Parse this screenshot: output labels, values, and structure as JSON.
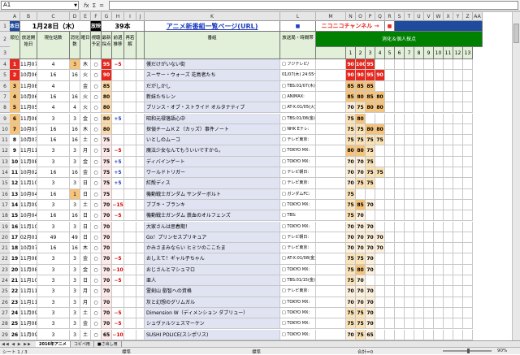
{
  "formula_bar": {
    "cell_ref": "A1",
    "formula": ""
  },
  "columns": [
    "A",
    "B",
    "C",
    "D",
    "E",
    "F",
    "G",
    "H",
    "I",
    "J",
    "K",
    "L",
    "M",
    "N",
    "O",
    "P",
    "Q",
    "R",
    "S",
    "T",
    "U",
    "V",
    "W",
    "X",
    "Y",
    "Z",
    "AA"
  ],
  "header": {
    "today_label": "本日",
    "date": "1月28日（木）",
    "count_label": "放映",
    "count": "39本",
    "title_link": "アニメ新番組一覧ページ(URL)",
    "marker_left": "■",
    "niconico": "ニコニコチャンネル →",
    "marker_right": "■",
    "score_group": "消化＆個人採点",
    "col_rank": "順位",
    "col_date": "放送開始日",
    "col_current": "現在話数",
    "col_watched": "消化数",
    "col_weekday": "曜日",
    "col_plan": "視聴予定",
    "col_latest": "最新採点",
    "col_prev": "前週推移",
    "col_diff": "再若解",
    "col_title": "番組",
    "col_station": "放送局・時間帯",
    "score_numbers": [
      "1",
      "2",
      "3",
      "4",
      "5",
      "6",
      "7",
      "8",
      "9",
      "10",
      "11",
      "12",
      "13"
    ]
  },
  "rows": [
    {
      "row": "1"
    },
    {
      "row": "2"
    },
    {
      "row": "3"
    },
    {
      "row": "4",
      "rank": "1",
      "date": "11月07日(木)",
      "cur": "4",
      "wat": "3",
      "wd": "木",
      "plan": "○",
      "score": "95",
      "trend": "−5",
      "title": "僕だけがいない街",
      "station": "□ フジテレビ/",
      "scores": [
        "90",
        "100",
        "95",
        "",
        "",
        "",
        "",
        "",
        "",
        "",
        "",
        "",
        ""
      ]
    },
    {
      "row": "5",
      "rank": "2",
      "date": "10月06日(火)",
      "cur": "16",
      "wat": "16",
      "wd": "火",
      "plan": "○",
      "score": "90",
      "trend": "",
      "title": "スーサー・ウォーズ 花鳥者たち",
      "station": "01/07(木) 24:55~",
      "scores": [
        "90",
        "90",
        "95",
        "90",
        "",
        "",
        "",
        "",
        "",
        "",
        "",
        "",
        ""
      ]
    },
    {
      "row": "6",
      "rank": "3",
      "date": "11月08日(金)",
      "cur": "4",
      "wat": "",
      "wd": "金",
      "plan": "○",
      "score": "85",
      "trend": "",
      "title": "だがしかし",
      "station": "□ TBS:01/07(木)",
      "scores": [
        "85",
        "85",
        "85",
        "",
        "",
        "",
        "",
        "",
        "",
        "",
        "",
        "",
        ""
      ]
    },
    {
      "row": "7",
      "rank": "4",
      "date": "10月06日(火)",
      "cur": "16",
      "wat": "16",
      "wd": "火",
      "plan": "○",
      "score": "80",
      "trend": "",
      "title": "新妹たちレン",
      "station": "□ ANIMAX:",
      "scores": [
        "85",
        "80",
        "85",
        "80",
        "",
        "",
        "",
        "",
        "",
        "",
        "",
        "",
        ""
      ]
    },
    {
      "row": "8",
      "rank": "5",
      "date": "11月05日(火)",
      "cur": "4",
      "wat": "4",
      "wd": "火",
      "plan": "○",
      "score": "80",
      "trend": "",
      "title": "プリンス・オブ・ストライド オルタナティブ",
      "station": "□ AT-X:01/05(火)",
      "scores": [
        "70",
        "75",
        "80",
        "80",
        "",
        "",
        "",
        "",
        "",
        "",
        "",
        "",
        ""
      ]
    },
    {
      "row": "9",
      "rank": "6",
      "date": "11月08日(金)",
      "cur": "3",
      "wat": "3",
      "wd": "金",
      "plan": "○",
      "score": "80",
      "trend": "+5",
      "title": "昭和元禄落語心中",
      "station": "□ TBS:01/08(金)",
      "scores": [
        "75",
        "80",
        "",
        "",
        "",
        "",
        "",
        "",
        "",
        "",
        "",
        "",
        ""
      ]
    },
    {
      "row": "10",
      "rank": "7",
      "date": "10月07日(木)",
      "cur": "16",
      "wat": "16",
      "wd": "木",
      "plan": "○",
      "score": "80",
      "trend": "",
      "title": "探偵チームＫＺ（カッズ）事件ノート",
      "station": "□ NHK Eテレ:",
      "scores": [
        "75",
        "75",
        "80",
        "80",
        "",
        "",
        "",
        "",
        "",
        "",
        "",
        "",
        ""
      ]
    },
    {
      "row": "11",
      "rank": "8",
      "date": "10月03日(土)",
      "cur": "16",
      "wat": "16",
      "wd": "土",
      "plan": "○",
      "score": "75",
      "trend": "",
      "title": "いとしのムーコ",
      "station": "□ テレビ東京:",
      "scores": [
        "75",
        "75",
        "75",
        "75",
        "",
        "",
        "",
        "",
        "",
        "",
        "",
        "",
        ""
      ]
    },
    {
      "row": "12",
      "rank": "9",
      "date": "11月11日(月)",
      "cur": "3",
      "wat": "3",
      "wd": "月",
      "plan": "○",
      "score": "75",
      "trend": "−5",
      "title": "魔法少女なんてもういいですから。",
      "station": "□ TOKYO MX:",
      "scores": [
        "80",
        "80",
        "75",
        "",
        "",
        "",
        "",
        "",
        "",
        "",
        "",
        "",
        ""
      ]
    },
    {
      "row": "13",
      "rank": "10",
      "date": "11月08日(金)",
      "cur": "3",
      "wat": "3",
      "wd": "金",
      "plan": "○",
      "score": "75",
      "trend": "+5",
      "title": "ディバインゲート",
      "station": "□ TOKYO MX:",
      "scores": [
        "70",
        "70",
        "75",
        "",
        "",
        "",
        "",
        "",
        "",
        "",
        "",
        "",
        ""
      ]
    },
    {
      "row": "14",
      "rank": "11",
      "date": "10月02日(金)",
      "cur": "16",
      "wat": "16",
      "wd": "金",
      "plan": "○",
      "score": "75",
      "trend": "+5",
      "title": "ワールドトリガー",
      "station": "□ テレビ朝日:",
      "scores": [
        "70",
        "70",
        "75",
        "75",
        "",
        "",
        "",
        "",
        "",
        "",
        "",
        "",
        ""
      ]
    },
    {
      "row": "15",
      "rank": "12",
      "date": "11月10日(日)",
      "cur": "3",
      "wat": "3",
      "wd": "日",
      "plan": "○",
      "score": "75",
      "trend": "+5",
      "title": "紅殻ディス",
      "station": "□ テレビ東京:",
      "scores": [
        "70",
        "75",
        "75",
        "",
        "",
        "",
        "",
        "",
        "",
        "",
        "",
        "",
        ""
      ]
    },
    {
      "row": "16",
      "rank": "13",
      "date": "10月04日(日)",
      "cur": "16",
      "wat": "1",
      "wd": "日",
      "plan": "○",
      "score": "75",
      "trend": "",
      "title": "機動戦士ガンダム サンダーボルト",
      "station": "□ ガンダムFC:",
      "scores": [
        "75",
        "",
        "",
        "",
        "",
        "",
        "",
        "",
        "",
        "",
        "",
        "",
        ""
      ]
    },
    {
      "row": "17",
      "rank": "14",
      "date": "11月09日(土)",
      "cur": "3",
      "wat": "3",
      "wd": "土",
      "plan": "○",
      "score": "70",
      "trend": "−15",
      "title": "ブブキ・ブランキ",
      "station": "□ TOKYO MX:",
      "scores": [
        "75",
        "85",
        "70",
        "",
        "",
        "",
        "",
        "",
        "",
        "",
        "",
        "",
        ""
      ]
    },
    {
      "row": "18",
      "rank": "15",
      "date": "10月04日(日)",
      "cur": "16",
      "wat": "16",
      "wd": "日",
      "plan": "○",
      "score": "70",
      "trend": "−5",
      "title": "機動戦士ガンダム 鉄血のオルフェンズ",
      "station": "□ TBS:",
      "scores": [
        "75",
        "70",
        "",
        "",
        "",
        "",
        "",
        "",
        "",
        "",
        "",
        "",
        ""
      ]
    },
    {
      "row": "19",
      "rank": "16",
      "date": "11月10日(日)",
      "cur": "3",
      "wat": "3",
      "wd": "日",
      "plan": "○",
      "score": "70",
      "trend": "",
      "title": "大家さんは思春期！",
      "station": "□ TOKYO MX:",
      "scores": [
        "70",
        "70",
        "70",
        "",
        "",
        "",
        "",
        "",
        "",
        "",
        "",
        "",
        ""
      ]
    },
    {
      "row": "20",
      "rank": "17",
      "date": "02月01日(日)",
      "cur": "49",
      "wat": "49",
      "wd": "日",
      "plan": "○",
      "score": "70",
      "trend": "",
      "title": "Go！プリンセスプリキュア",
      "station": "□ テレビ朝日:",
      "scores": [
        "70",
        "70",
        "70",
        "70",
        "",
        "",
        "",
        "",
        "",
        "",
        "",
        "",
        ""
      ]
    },
    {
      "row": "21",
      "rank": "18",
      "date": "10月07日(木)",
      "cur": "16",
      "wat": "16",
      "wd": "木",
      "plan": "○",
      "score": "70",
      "trend": "",
      "title": "かみさまみならい ヒミツのここたま",
      "station": "□ テレビ東京:",
      "scores": [
        "70",
        "70",
        "70",
        "70",
        "",
        "",
        "",
        "",
        "",
        "",
        "",
        "",
        ""
      ]
    },
    {
      "row": "22",
      "rank": "19",
      "date": "11月08日(金)",
      "cur": "3",
      "wat": "3",
      "wd": "金",
      "plan": "○",
      "score": "70",
      "trend": "−5",
      "title": "おしえて！ギャル子ちゃん",
      "station": "□ AT-X:01/08(金)",
      "scores": [
        "75",
        "75",
        "70",
        "",
        "",
        "",
        "",
        "",
        "",
        "",
        "",
        "",
        ""
      ]
    },
    {
      "row": "23",
      "rank": "20",
      "date": "11月08日(金)",
      "cur": "3",
      "wat": "3",
      "wd": "金",
      "plan": "○",
      "score": "70",
      "trend": "−10",
      "title": "おじさんとマシュマロ",
      "station": "□ TOKYO MX:",
      "scores": [
        "75",
        "80",
        "70",
        "",
        "",
        "",
        "",
        "",
        "",
        "",
        "",
        "",
        ""
      ]
    },
    {
      "row": "24",
      "rank": "21",
      "date": "11月10日(日)",
      "cur": "3",
      "wat": "3",
      "wd": "日",
      "plan": "○",
      "score": "70",
      "trend": "−5",
      "title": "亜人",
      "station": "□ TBS:01/15(金)",
      "scores": [
        "75",
        "70",
        "",
        "",
        "",
        "",
        "",
        "",
        "",
        "",
        "",
        "",
        ""
      ]
    },
    {
      "row": "25",
      "rank": "22",
      "date": "11月11日(月)",
      "cur": "3",
      "wat": "3",
      "wd": "月",
      "plan": "○",
      "score": "70",
      "trend": "",
      "title": "霊剣山 叡智への資格",
      "station": "□ テレビ東京:",
      "scores": [
        "70",
        "70",
        "70",
        "",
        "",
        "",
        "",
        "",
        "",
        "",
        "",
        "",
        ""
      ]
    },
    {
      "row": "26",
      "rank": "23",
      "date": "11月11日(月)",
      "cur": "3",
      "wat": "3",
      "wd": "月",
      "plan": "○",
      "score": "70",
      "trend": "",
      "title": "灰と幻想のグリムガル",
      "station": "□ TOKYO MX:",
      "scores": [
        "70",
        "70",
        "70",
        "",
        "",
        "",
        "",
        "",
        "",
        "",
        "",
        "",
        ""
      ]
    },
    {
      "row": "27",
      "rank": "24",
      "date": "11月09日(土)",
      "cur": "3",
      "wat": "3",
      "wd": "土",
      "plan": "○",
      "score": "70",
      "trend": "−5",
      "title": "Dimension W（ディメンション ダブリュー）",
      "station": "□ TOKYO MX:",
      "scores": [
        "75",
        "75",
        "70",
        "",
        "",
        "",
        "",
        "",
        "",
        "",
        "",
        "",
        ""
      ]
    },
    {
      "row": "28",
      "rank": "25",
      "date": "11月08日(金)",
      "cur": "3",
      "wat": "3",
      "wd": "金",
      "plan": "○",
      "score": "70",
      "trend": "−5",
      "title": "シュヴァルツェスマーケン",
      "station": "□ TOKYO MX:",
      "scores": [
        "75",
        "75",
        "70",
        "",
        "",
        "",
        "",
        "",
        "",
        "",
        "",
        "",
        ""
      ]
    },
    {
      "row": "29",
      "rank": "26",
      "date": "11月09日(土)",
      "cur": "3",
      "wat": "3",
      "wd": "土",
      "plan": "○",
      "score": "65",
      "trend": "−10",
      "title": "SUSHI POLICE(スシポリス)",
      "station": "□ TOKYO MX:",
      "scores": [
        "70",
        "75",
        "65",
        "",
        "",
        "",
        "",
        "",
        "",
        "",
        "",
        "",
        ""
      ]
    }
  ],
  "sheet_tabs": [
    "2016年アニメ",
    "コピペ用",
    "■さ出し用"
  ],
  "status": {
    "sheet": "シート 1 / 3",
    "style": "標準",
    "lang": "標準",
    "sum": "合計=0",
    "zoom": "90%"
  },
  "colors": {
    "blue_header": "#1f4b9e",
    "green_header": "#008000",
    "rank_red": "#e8281f",
    "watched_orange": "#f6c37a"
  }
}
